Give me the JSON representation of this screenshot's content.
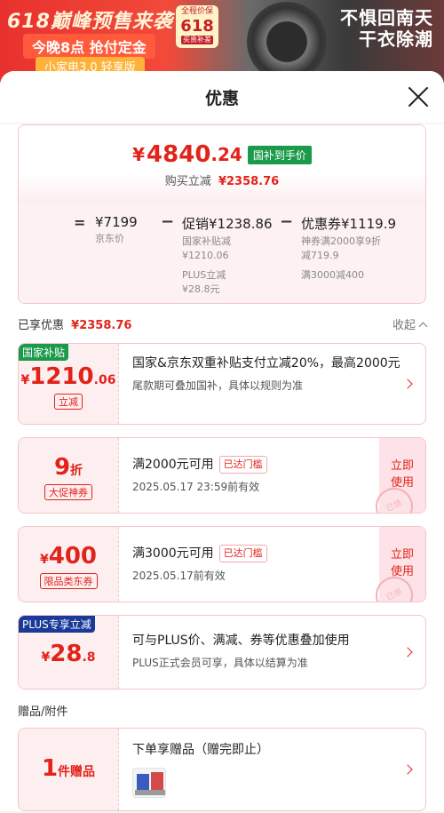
{
  "banner": {
    "headline": "618巅峰预售来袭",
    "subline": "今晚8点 抢付定金",
    "ribbon": "小家电3.0 轻享版",
    "promo_small": "全程价保",
    "promo_big": "618",
    "promo_tag": "买贵补差",
    "slogan_line1": "不惧回南天",
    "slogan_line2": "干衣除潮"
  },
  "sheet": {
    "title": "优惠"
  },
  "summary": {
    "price_currency": "¥",
    "price_int": "4840",
    "price_dec": ".24",
    "price_tag": "国补到手价",
    "buy_label": "购买立减",
    "buy_amount": "¥2358.76",
    "eq": "=",
    "minus": "−",
    "jd_price": "¥7199",
    "jd_price_label": "京东价",
    "promo_main": "促销¥1238.86",
    "promo_sub1": "国家补贴减",
    "promo_sub1_val": "¥1210.06",
    "promo_sub2": "PLUS立减",
    "promo_sub2_val": "¥28.8元",
    "coupon_main": "优惠券¥1119.9",
    "coupon_sub1": "神券满2000享9折",
    "coupon_sub1_val": "减719.9",
    "coupon_sub2": "满3000减400"
  },
  "enjoyed": {
    "label": "已享优惠",
    "amount": "¥2358.76",
    "collapse": "收起"
  },
  "coupons": [
    {
      "badge": "国家补贴",
      "cur": "¥",
      "num": "1210",
      "dec": ".06",
      "tag": "立减",
      "title": "国家&京东双重补贴支付立减20%，最高2000元",
      "sub": "尾款期可叠加国补，具体以规则为准"
    },
    {
      "num": "9",
      "unit": "折",
      "tag": "大促神券",
      "title": "满2000元可用",
      "met": "已达门槛",
      "sub": "2025.05.17 23:59前有效",
      "use": "立即使用",
      "stamp": "已领"
    },
    {
      "cur": "¥",
      "num": "400",
      "tag": "限品类东券",
      "title": "满3000元可用",
      "met": "已达门槛",
      "sub": "2025.05.17前有效",
      "use": "立即使用",
      "stamp": "已领"
    },
    {
      "badge": "PLUS专享立减",
      "cur": "¥",
      "num": "28",
      "dec": ".8",
      "title": "可与PLUS价、满减、券等优惠叠加使用",
      "sub": "PLUS正式会员可享，具体以结算为准"
    }
  ],
  "gifts": {
    "section": "赠品/附件",
    "count": "1",
    "unit": "件赠品",
    "title": "下单享赠品（赠完即止）"
  }
}
